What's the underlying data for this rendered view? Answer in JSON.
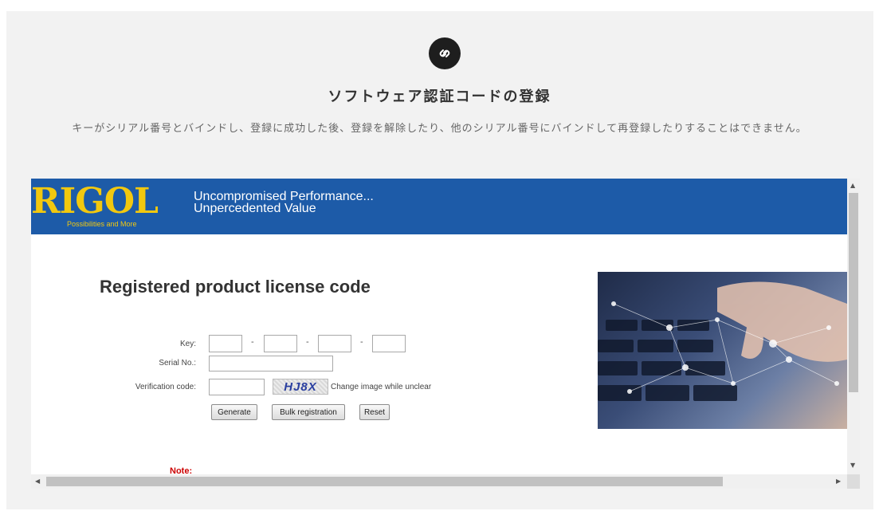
{
  "header": {
    "icon": "link-icon",
    "title": "ソフトウェア認証コードの登録",
    "description": "キーがシリアル番号とバインドし、登録に成功した後、登録を解除したり、他のシリアル番号にバインドして再登録したりすることはできません。"
  },
  "banner": {
    "logo_text": "RIGOL",
    "logo_subtext": "Possibilities and More",
    "tagline_line1": "Uncompromised Performance...",
    "tagline_line2": "Unpercedented Value",
    "background_color": "#1d5ba8",
    "logo_color": "#f2c80f"
  },
  "form": {
    "title": "Registered product license code",
    "key_label": "Key:",
    "key_separator": "-",
    "key_values": [
      "",
      "",
      "",
      ""
    ],
    "serial_label": "Serial No.:",
    "serial_value": "",
    "verification_label": "Verification code:",
    "verification_value": "",
    "captcha_text": "HJ8X",
    "change_image_text": "Change image while unclear",
    "buttons": {
      "generate": "Generate",
      "bulk": "Bulk registration",
      "reset": "Reset"
    },
    "note_label": "Note:"
  },
  "scrollbars": {
    "up": "▲",
    "down": "▼",
    "left": "◀",
    "right": "▶"
  }
}
